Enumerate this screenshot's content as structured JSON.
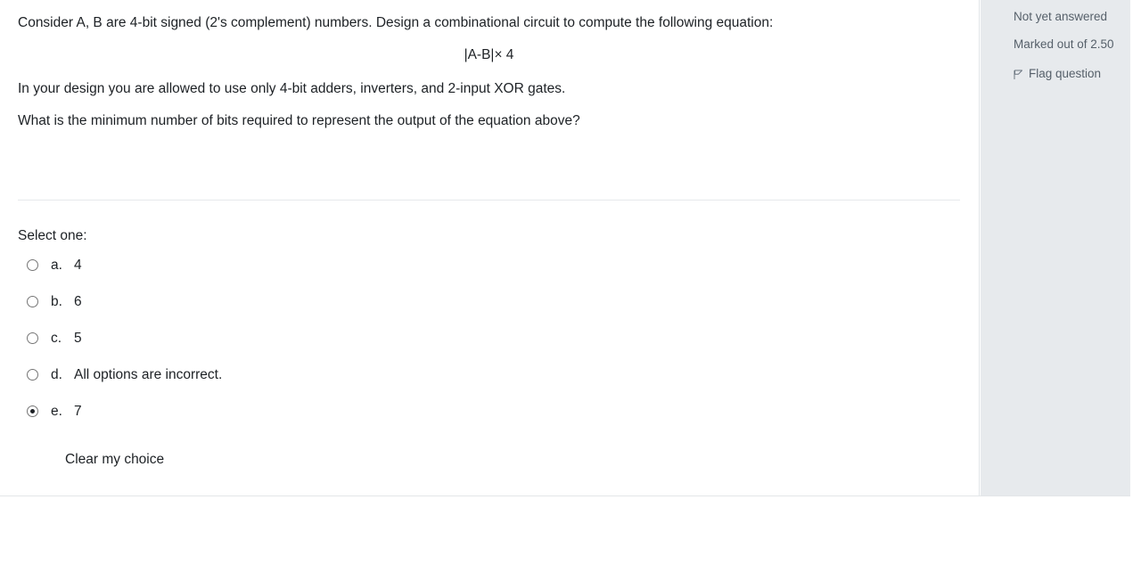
{
  "question": {
    "text_lines": [
      "Consider A, B are 4-bit signed (2's complement) numbers. Design a combinational circuit to compute the following equation:",
      "|A-B|× 4",
      "In your design you are allowed to use only 4-bit adders, inverters, and 2-input XOR gates.",
      "What is the minimum number of bits required to represent the output of the equation above?"
    ],
    "prompt": "Select one:",
    "options": [
      {
        "letter": "a.",
        "text": "4",
        "selected": false
      },
      {
        "letter": "b.",
        "text": "6",
        "selected": false
      },
      {
        "letter": "c.",
        "text": "5",
        "selected": false
      },
      {
        "letter": "d.",
        "text": "All options are incorrect.",
        "selected": false
      },
      {
        "letter": "e.",
        "text": "7",
        "selected": true
      }
    ],
    "clear_choice_label": "Clear my choice"
  },
  "info": {
    "state": "Not yet answered",
    "grade": "Marked out of 2.50",
    "flag_label": "Flag question",
    "flag_icon": "flag-icon",
    "background_color": "#e7eaed",
    "text_color": "#56606a"
  }
}
